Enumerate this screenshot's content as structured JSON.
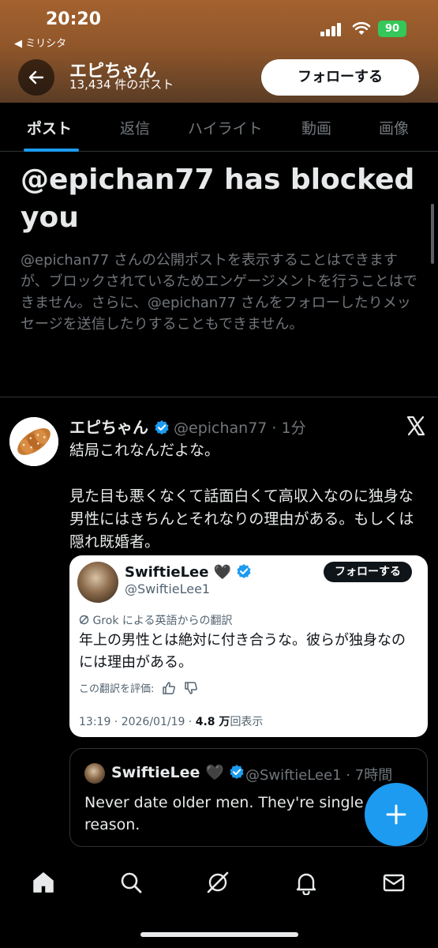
{
  "status_bar": {
    "time": "20:20",
    "back_app": "◀ ミリシタ",
    "battery": "90"
  },
  "header": {
    "name": "エピちゃん",
    "post_count": "13,434 件のポスト",
    "follow_label": "フォローする"
  },
  "tabs": [
    {
      "label": "ポスト",
      "active": true
    },
    {
      "label": "返信",
      "active": false
    },
    {
      "label": "ハイライト",
      "active": false
    },
    {
      "label": "動画",
      "active": false
    },
    {
      "label": "画像",
      "active": false
    }
  ],
  "blocked": {
    "title": "@epichan77 has blocked you",
    "description": "@epichan77 さんの公開ポストを表示することはできますが、ブロックされているためエンゲージメントを行うことはできません。さらに、@epichan77 さんをフォローしたりメッセージを送信したりすることもできません。"
  },
  "post": {
    "name": "エピちゃん",
    "handle_time": "@epichan77 · 1分",
    "text": "結局これなんだよな。\n\n見た目も悪くなくて話面白くて高収入なのに独身な男性にはきちんとそれなりの理由がある。もしくは隠れ既婚者。"
  },
  "quote": {
    "name": "SwiftieLee 🖤",
    "handle": "@SwiftieLee1",
    "follow_label": "フォローする",
    "grok_note": "Grok による英語からの翻訳",
    "text": "年上の男性とは絶対に付き合うな。彼らが独身なのには理由がある。",
    "rate_label": "この翻訳を評価:",
    "meta_time": "13:19 · 2026/01/19 · ",
    "meta_views_count": "4.8 万",
    "meta_views_label": "回表示"
  },
  "quote2": {
    "name": "SwiftieLee 🖤",
    "handle_time": "@SwiftieLee1 · 7時間",
    "text": "Never date older men. They're single for a reason."
  },
  "colors": {
    "accent": "#1d9bf0",
    "bg": "#000000",
    "muted": "#71767b",
    "text": "#e7e9ea"
  },
  "nav_icons": [
    "home-icon",
    "search-icon",
    "grok-icon",
    "bell-icon",
    "mail-icon"
  ]
}
